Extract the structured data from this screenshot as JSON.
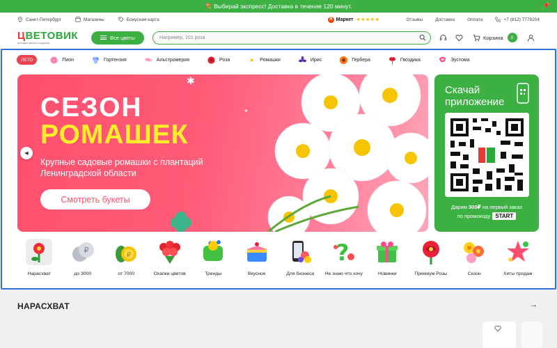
{
  "promo": {
    "text": "💐 Выбирай экспресс! Доставка в течение 120 минут."
  },
  "topbar": {
    "city": "Санкт-Петербург",
    "stores": "Магазины",
    "bonus": "Бонусная карта",
    "market_label": "Маркет",
    "market_stars": "★★★★★",
    "links": [
      "Отзывы",
      "Доставка",
      "Оплата"
    ],
    "phone": "+7 (812) 7779204"
  },
  "header": {
    "logo_first": "Ц",
    "logo_rest": "ВЕТОВИК",
    "logo_tagline": "Доставка цветов и подарков",
    "all_flowers": "Все цветы",
    "search_placeholder": "Например, 101 роза",
    "cart_label": "Корзина",
    "cart_count": "0"
  },
  "categories": {
    "pill": "ЛЕТО",
    "items": [
      "Пион",
      "Гортензия",
      "Альстромерия",
      "Роза",
      "Ромашки",
      "Ирис",
      "Гербера",
      "Гвоздика",
      "Эустома"
    ]
  },
  "banner": {
    "title_line1": "СЕЗОН",
    "title_line2": "РОМАШЕК",
    "subtitle": "Крупные садовые ромашки с плантаций Ленинградской области",
    "cta": "Смотреть букеты"
  },
  "app_card": {
    "title": "Скачай приложение",
    "offer_pre": "Дарим",
    "offer_amount": "300₽",
    "offer_post": "на первый заказ",
    "promo_label": "по промокоду",
    "promo_code": "START"
  },
  "quick_links": [
    "Нарасхват",
    "до 3000",
    "от 7000",
    "Охапки цветов",
    "Тренды",
    "Вкусное",
    "Для бизнеса",
    "Не знаю что хочу",
    "Новинки",
    "Премиум Розы",
    "Сезон",
    "Хиты продаж"
  ],
  "section": {
    "title": "НАРАСХВАТ"
  },
  "colors": {
    "brand_green": "#3cb043",
    "banner_pink": "#ff4f6e",
    "accent_yellow": "#ffee2a",
    "pill_red": "#e8424f"
  }
}
